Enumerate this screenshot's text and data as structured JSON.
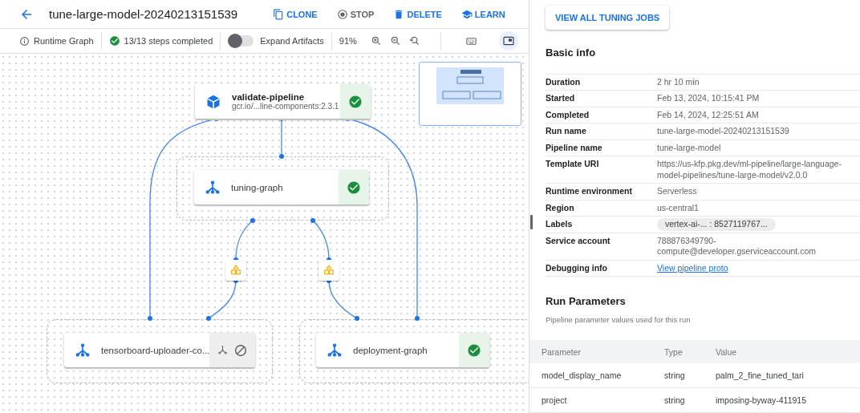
{
  "header": {
    "title": "tune-large-model-20240213151539",
    "actions": [
      {
        "label": "CLONE",
        "kind": "clone",
        "disabled": false
      },
      {
        "label": "STOP",
        "kind": "stop",
        "disabled": true
      },
      {
        "label": "DELETE",
        "kind": "delete",
        "disabled": false
      },
      {
        "label": "LEARN",
        "kind": "learn",
        "disabled": false
      }
    ]
  },
  "toolbar": {
    "view_label": "Runtime Graph",
    "steps_status": "13/13 steps completed",
    "expand_artifacts": {
      "label": "Expand Artifacts",
      "on": false
    },
    "zoom": "91%",
    "minimap_on": true
  },
  "graph": {
    "nodes": [
      {
        "name": "validate-pipeline",
        "subtitle": "gcr.io/...line-components:2.3.1",
        "kind": "container",
        "succeeded": true
      },
      {
        "name": "tuning-graph",
        "kind": "graph",
        "succeeded": true
      },
      {
        "name": "tensorboard-uploader-co...",
        "kind": "graph",
        "succeeded": false
      },
      {
        "name": "deployment-graph",
        "kind": "graph",
        "succeeded": true
      }
    ]
  },
  "details": {
    "button": "VIEW ALL TUNING JOBS",
    "basic_info": {
      "title": "Basic info",
      "rows": [
        {
          "label": "Duration",
          "value": "2 hr 10 min",
          "kind": "text"
        },
        {
          "label": "Started",
          "value": "Feb 13, 2024, 10:15:41 PM",
          "kind": "text"
        },
        {
          "label": "Completed",
          "value": "Feb 14, 2024, 12:25:51 AM",
          "kind": "text"
        },
        {
          "label": "Run name",
          "value": "tune-large-model-20240213151539",
          "kind": "text"
        },
        {
          "label": "Pipeline name",
          "value": "tune-large-model",
          "kind": "text"
        },
        {
          "label": "Template URI",
          "value": "https://us-kfp.pkg.dev/ml-pipeline/large-language-model-pipelines/tune-large-model/v2.0.0",
          "kind": "text"
        },
        {
          "label": "Runtime environment",
          "value": "Serverless",
          "kind": "text"
        },
        {
          "label": "Region",
          "value": "us-central1",
          "kind": "text"
        },
        {
          "label": "Labels",
          "value": "vertex-ai-... : 8527119767...",
          "kind": "chip"
        },
        {
          "label": "Service account",
          "value": "788876349790-compute@developer.gserviceaccount.com",
          "kind": "text"
        },
        {
          "label": "Debugging info",
          "value": "View pipeline proto",
          "kind": "link"
        }
      ]
    },
    "run_parameters": {
      "title": "Run Parameters",
      "subtitle": "Pipeline parameter values used for this run",
      "columns": [
        "Parameter",
        "Type",
        "Value"
      ],
      "rows": [
        [
          "model_display_name",
          "string",
          "palm_2_fine_tuned_tari"
        ],
        [
          "project",
          "string",
          "imposing-byway-411915"
        ]
      ]
    }
  }
}
